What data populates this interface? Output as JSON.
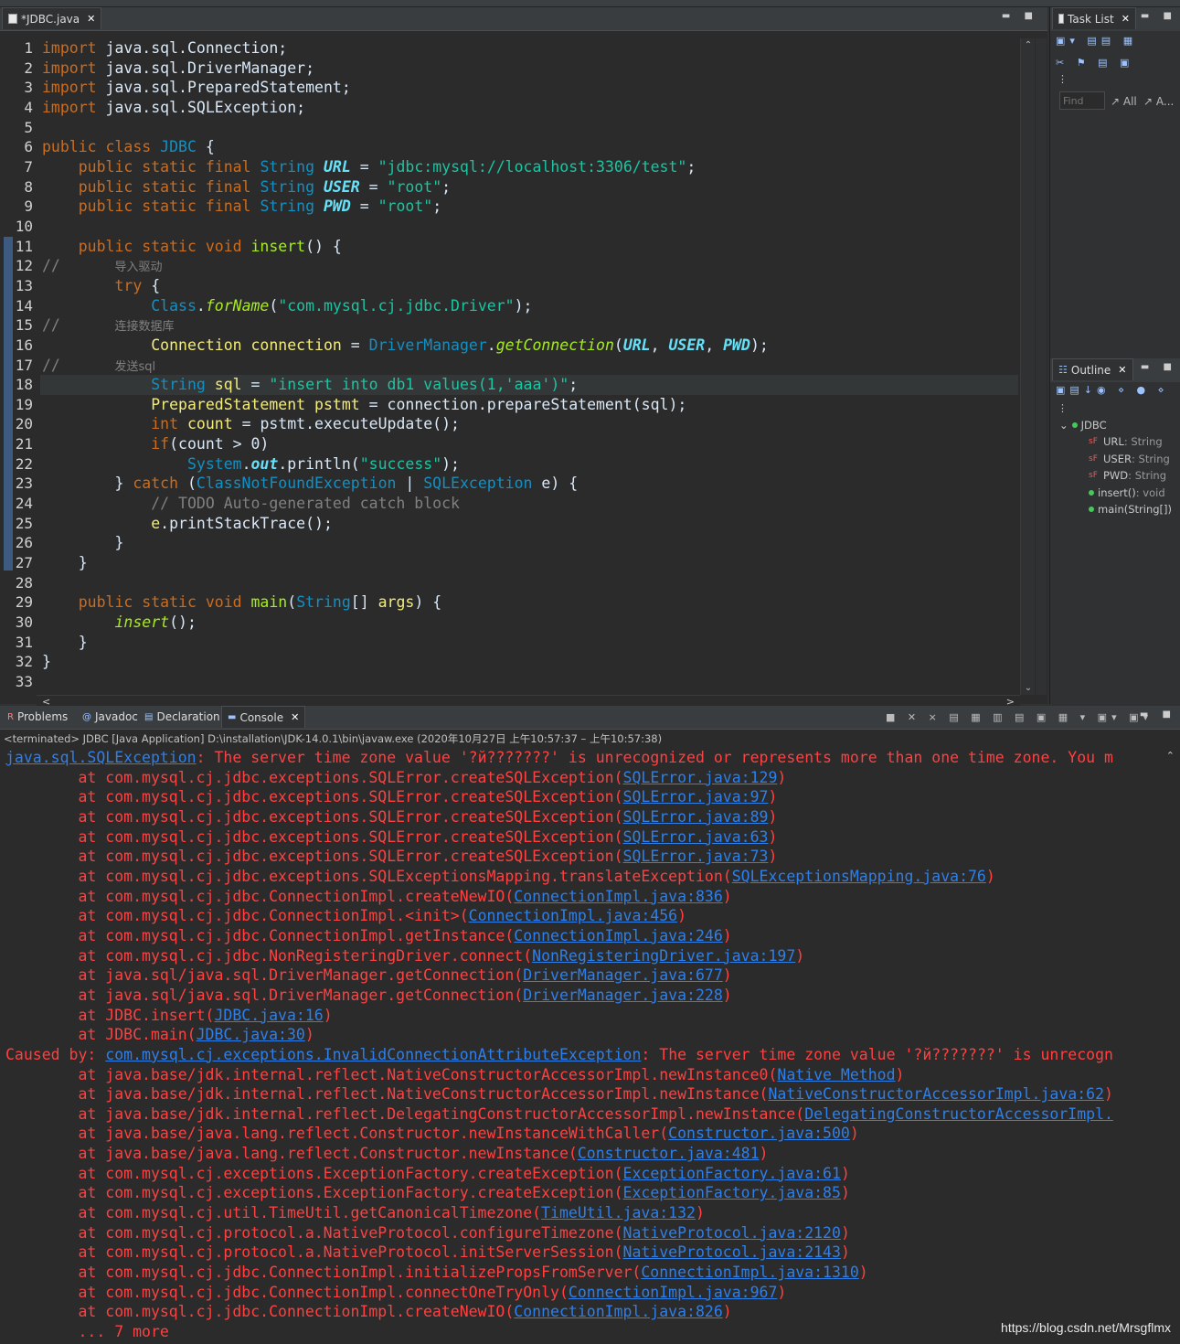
{
  "editor": {
    "tab_label": "*JDBC.java",
    "lines": [
      {
        "n": "1",
        "tokens": [
          {
            "t": "import",
            "c": "kw"
          },
          {
            "t": " java.sql.Connection;"
          }
        ]
      },
      {
        "n": "2",
        "tokens": [
          {
            "t": "import",
            "c": "kw"
          },
          {
            "t": " java.sql.DriverManager;"
          }
        ]
      },
      {
        "n": "3",
        "tokens": [
          {
            "t": "import",
            "c": "kw"
          },
          {
            "t": " java.sql.PreparedStatement;"
          }
        ]
      },
      {
        "n": "4",
        "tokens": [
          {
            "t": "import",
            "c": "kw"
          },
          {
            "t": " java.sql.SQLException;"
          }
        ]
      },
      {
        "n": "5",
        "tokens": []
      },
      {
        "n": "6",
        "tokens": [
          {
            "t": "public class ",
            "c": "kw"
          },
          {
            "t": "JDBC",
            "c": "cls"
          },
          {
            "t": " {"
          }
        ]
      },
      {
        "n": "7",
        "tokens": [
          {
            "t": "    "
          },
          {
            "t": "public static final ",
            "c": "kw"
          },
          {
            "t": "String",
            "c": "ty"
          },
          {
            "t": " "
          },
          {
            "t": "URL",
            "c": "fld"
          },
          {
            "t": " = "
          },
          {
            "t": "\"jdbc:mysql://localhost:3306/test\"",
            "c": "str"
          },
          {
            "t": ";"
          }
        ]
      },
      {
        "n": "8",
        "tokens": [
          {
            "t": "    "
          },
          {
            "t": "public static final ",
            "c": "kw"
          },
          {
            "t": "String",
            "c": "ty"
          },
          {
            "t": " "
          },
          {
            "t": "USER",
            "c": "fld"
          },
          {
            "t": " = "
          },
          {
            "t": "\"root\"",
            "c": "str"
          },
          {
            "t": ";"
          }
        ]
      },
      {
        "n": "9",
        "tokens": [
          {
            "t": "    "
          },
          {
            "t": "public static final ",
            "c": "kw"
          },
          {
            "t": "String",
            "c": "ty"
          },
          {
            "t": " "
          },
          {
            "t": "PWD",
            "c": "fld"
          },
          {
            "t": " = "
          },
          {
            "t": "\"root\"",
            "c": "str"
          },
          {
            "t": ";"
          }
        ]
      },
      {
        "n": "10",
        "tokens": []
      },
      {
        "n": "11",
        "tokens": [
          {
            "t": "    "
          },
          {
            "t": "public static void ",
            "c": "kw"
          },
          {
            "t": "insert",
            "c": "meth"
          },
          {
            "t": "() {"
          }
        ]
      },
      {
        "n": "12",
        "tokens": [
          {
            "t": "//      ",
            "c": "cmt"
          },
          {
            "t": "导入驱动",
            "c": "cj"
          }
        ]
      },
      {
        "n": "13",
        "tokens": [
          {
            "t": "        "
          },
          {
            "t": "try",
            "c": "kw"
          },
          {
            "t": " {"
          }
        ]
      },
      {
        "n": "14",
        "tokens": [
          {
            "t": "            "
          },
          {
            "t": "Class",
            "c": "ty"
          },
          {
            "t": "."
          },
          {
            "t": "forName",
            "c": "itm"
          },
          {
            "t": "("
          },
          {
            "t": "\"com.mysql.cj.jdbc.Driver\"",
            "c": "str"
          },
          {
            "t": ");"
          }
        ]
      },
      {
        "n": "15",
        "tokens": [
          {
            "t": "//      ",
            "c": "cmt"
          },
          {
            "t": "连接数据库",
            "c": "cj"
          }
        ]
      },
      {
        "n": "16",
        "tokens": [
          {
            "t": "            "
          },
          {
            "t": "Connection",
            "c": "var"
          },
          {
            "t": " "
          },
          {
            "t": "connection",
            "c": "var"
          },
          {
            "t": " = "
          },
          {
            "t": "DriverManager",
            "c": "ty"
          },
          {
            "t": "."
          },
          {
            "t": "getConnection",
            "c": "itm"
          },
          {
            "t": "("
          },
          {
            "t": "URL",
            "c": "fld"
          },
          {
            "t": ", "
          },
          {
            "t": "USER",
            "c": "fld"
          },
          {
            "t": ", "
          },
          {
            "t": "PWD",
            "c": "fld"
          },
          {
            "t": ");"
          }
        ]
      },
      {
        "n": "17",
        "tokens": [
          {
            "t": "//      ",
            "c": "cmt"
          },
          {
            "t": "发送sql",
            "c": "cj"
          }
        ]
      },
      {
        "n": "18",
        "hl": true,
        "tokens": [
          {
            "t": "            "
          },
          {
            "t": "String",
            "c": "ty"
          },
          {
            "t": " "
          },
          {
            "t": "sql",
            "c": "var"
          },
          {
            "t": " = "
          },
          {
            "t": "\"insert into db1 values(1,'aaa')\"",
            "c": "str"
          },
          {
            "t": ";"
          }
        ]
      },
      {
        "n": "19",
        "tokens": [
          {
            "t": "            "
          },
          {
            "t": "PreparedStatement",
            "c": "var"
          },
          {
            "t": " "
          },
          {
            "t": "pstmt",
            "c": "var"
          },
          {
            "t": " = connection.prepareStatement(sql);"
          }
        ]
      },
      {
        "n": "20",
        "tokens": [
          {
            "t": "            "
          },
          {
            "t": "int",
            "c": "kw"
          },
          {
            "t": " "
          },
          {
            "t": "count",
            "c": "var"
          },
          {
            "t": " = pstmt.executeUpdate();"
          }
        ]
      },
      {
        "n": "21",
        "tokens": [
          {
            "t": "            "
          },
          {
            "t": "if",
            "c": "kw"
          },
          {
            "t": "(count > 0)"
          }
        ]
      },
      {
        "n": "22",
        "tokens": [
          {
            "t": "                "
          },
          {
            "t": "System",
            "c": "ty"
          },
          {
            "t": "."
          },
          {
            "t": "out",
            "c": "fld"
          },
          {
            "t": ".println("
          },
          {
            "t": "\"success\"",
            "c": "str"
          },
          {
            "t": ");"
          }
        ]
      },
      {
        "n": "23",
        "tokens": [
          {
            "t": "        } "
          },
          {
            "t": "catch",
            "c": "kw"
          },
          {
            "t": " ("
          },
          {
            "t": "ClassNotFoundException",
            "c": "ty"
          },
          {
            "t": " | "
          },
          {
            "t": "SQLException",
            "c": "ty"
          },
          {
            "t": " e) {"
          }
        ]
      },
      {
        "n": "24",
        "tokens": [
          {
            "t": "            "
          },
          {
            "t": "// TODO Auto-generated catch block",
            "c": "cmt"
          }
        ]
      },
      {
        "n": "25",
        "tokens": [
          {
            "t": "            "
          },
          {
            "t": "e",
            "c": "var"
          },
          {
            "t": ".printStackTrace();"
          }
        ]
      },
      {
        "n": "26",
        "tokens": [
          {
            "t": "        }"
          }
        ]
      },
      {
        "n": "27",
        "tokens": [
          {
            "t": "    }"
          }
        ]
      },
      {
        "n": "28",
        "tokens": []
      },
      {
        "n": "29",
        "tokens": [
          {
            "t": "    "
          },
          {
            "t": "public static void ",
            "c": "kw"
          },
          {
            "t": "main",
            "c": "meth"
          },
          {
            "t": "("
          },
          {
            "t": "String",
            "c": "ty"
          },
          {
            "t": "[] "
          },
          {
            "t": "args",
            "c": "var"
          },
          {
            "t": ") {"
          }
        ]
      },
      {
        "n": "30",
        "tokens": [
          {
            "t": "        "
          },
          {
            "t": "insert",
            "c": "itm"
          },
          {
            "t": "();"
          }
        ]
      },
      {
        "n": "31",
        "tokens": [
          {
            "t": "    }"
          }
        ]
      },
      {
        "n": "32",
        "tokens": [
          {
            "t": "}"
          }
        ]
      },
      {
        "n": "33",
        "tokens": []
      }
    ]
  },
  "task_list": {
    "tab_label": "Task List",
    "find_placeholder": "Find",
    "all_label": "All",
    "activate_label": "A..."
  },
  "outline": {
    "tab_label": "Outline",
    "class_name": "JDBC",
    "items": [
      {
        "name": "URL",
        "type": " : String",
        "kind": "field"
      },
      {
        "name": "USER",
        "type": " : String",
        "kind": "field"
      },
      {
        "name": "PWD",
        "type": " : String",
        "kind": "field"
      },
      {
        "name": "insert()",
        "type": " : void",
        "kind": "method"
      },
      {
        "name": "main(String[])",
        "type": "",
        "kind": "method"
      }
    ]
  },
  "bottom_tabs": [
    "Problems",
    "Javadoc",
    "Declaration",
    "Console"
  ],
  "console": {
    "terminated_line": "<terminated> JDBC [Java Application] D:\\installation\\JDK-14.0.1\\bin\\javaw.exe  (2020年10月27日 上午10:57:37 – 上午10:57:38)",
    "lines": [
      {
        "pre": "",
        "link": "java.sql.SQLException",
        "post": ": The server time zone value '?й???????' is unrecognized or represents more than one time zone. You m"
      },
      {
        "pre": "        at com.mysql.cj.jdbc.exceptions.SQLError.createSQLException(",
        "link": "SQLError.java:129",
        "post": ")"
      },
      {
        "pre": "        at com.mysql.cj.jdbc.exceptions.SQLError.createSQLException(",
        "link": "SQLError.java:97",
        "post": ")"
      },
      {
        "pre": "        at com.mysql.cj.jdbc.exceptions.SQLError.createSQLException(",
        "link": "SQLError.java:89",
        "post": ")"
      },
      {
        "pre": "        at com.mysql.cj.jdbc.exceptions.SQLError.createSQLException(",
        "link": "SQLError.java:63",
        "post": ")"
      },
      {
        "pre": "        at com.mysql.cj.jdbc.exceptions.SQLError.createSQLException(",
        "link": "SQLError.java:73",
        "post": ")"
      },
      {
        "pre": "        at com.mysql.cj.jdbc.exceptions.SQLExceptionsMapping.translateException(",
        "link": "SQLExceptionsMapping.java:76",
        "post": ")"
      },
      {
        "pre": "        at com.mysql.cj.jdbc.ConnectionImpl.createNewIO(",
        "link": "ConnectionImpl.java:836",
        "post": ")"
      },
      {
        "pre": "        at com.mysql.cj.jdbc.ConnectionImpl.<init>(",
        "link": "ConnectionImpl.java:456",
        "post": ")"
      },
      {
        "pre": "        at com.mysql.cj.jdbc.ConnectionImpl.getInstance(",
        "link": "ConnectionImpl.java:246",
        "post": ")"
      },
      {
        "pre": "        at com.mysql.cj.jdbc.NonRegisteringDriver.connect(",
        "link": "NonRegisteringDriver.java:197",
        "post": ")"
      },
      {
        "pre": "        at java.sql/java.sql.DriverManager.getConnection(",
        "link": "DriverManager.java:677",
        "post": ")"
      },
      {
        "pre": "        at java.sql/java.sql.DriverManager.getConnection(",
        "link": "DriverManager.java:228",
        "post": ")"
      },
      {
        "pre": "        at JDBC.insert(",
        "link": "JDBC.java:16",
        "post": ")"
      },
      {
        "pre": "        at JDBC.main(",
        "link": "JDBC.java:30",
        "post": ")"
      },
      {
        "pre": "Caused by: ",
        "link": "com.mysql.cj.exceptions.InvalidConnectionAttributeException",
        "post": ": The server time zone value '?й???????' is unrecogn"
      },
      {
        "pre": "        at java.base/jdk.internal.reflect.NativeConstructorAccessorImpl.newInstance0(",
        "link": "Native Method",
        "post": ")"
      },
      {
        "pre": "        at java.base/jdk.internal.reflect.NativeConstructorAccessorImpl.newInstance(",
        "link": "NativeConstructorAccessorImpl.java:62",
        "post": ")"
      },
      {
        "pre": "        at java.base/jdk.internal.reflect.DelegatingConstructorAccessorImpl.newInstance(",
        "link": "DelegatingConstructorAccessorImpl.",
        "post": ""
      },
      {
        "pre": "        at java.base/java.lang.reflect.Constructor.newInstanceWithCaller(",
        "link": "Constructor.java:500",
        "post": ")"
      },
      {
        "pre": "        at java.base/java.lang.reflect.Constructor.newInstance(",
        "link": "Constructor.java:481",
        "post": ")"
      },
      {
        "pre": "        at com.mysql.cj.exceptions.ExceptionFactory.createException(",
        "link": "ExceptionFactory.java:61",
        "post": ")"
      },
      {
        "pre": "        at com.mysql.cj.exceptions.ExceptionFactory.createException(",
        "link": "ExceptionFactory.java:85",
        "post": ")"
      },
      {
        "pre": "        at com.mysql.cj.util.TimeUtil.getCanonicalTimezone(",
        "link": "TimeUtil.java:132",
        "post": ")"
      },
      {
        "pre": "        at com.mysql.cj.protocol.a.NativeProtocol.configureTimezone(",
        "link": "NativeProtocol.java:2120",
        "post": ")"
      },
      {
        "pre": "        at com.mysql.cj.protocol.a.NativeProtocol.initServerSession(",
        "link": "NativeProtocol.java:2143",
        "post": ")"
      },
      {
        "pre": "        at com.mysql.cj.jdbc.ConnectionImpl.initializePropsFromServer(",
        "link": "ConnectionImpl.java:1310",
        "post": ")"
      },
      {
        "pre": "        at com.mysql.cj.jdbc.ConnectionImpl.connectOneTryOnly(",
        "link": "ConnectionImpl.java:967",
        "post": ")"
      },
      {
        "pre": "        at com.mysql.cj.jdbc.ConnectionImpl.createNewIO(",
        "link": "ConnectionImpl.java:826",
        "post": ")"
      },
      {
        "pre": "        ... 7 more",
        "link": "",
        "post": ""
      }
    ]
  },
  "watermark": "https://blog.csdn.net/Mrsgflmx"
}
